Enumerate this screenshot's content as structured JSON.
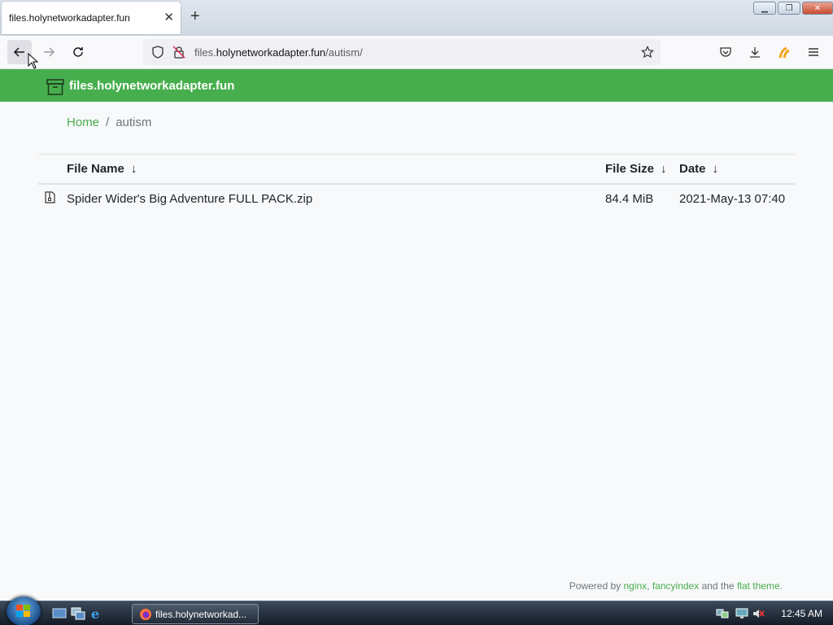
{
  "browser": {
    "tab_title": "files.holynetworkadapter.fun",
    "url_host": "files.holynetworkadapter.fun",
    "url_prefix": "files.",
    "url_domain": "holynetworkadapter.fun",
    "url_path": "/autism/"
  },
  "site": {
    "title": "files.holynetworkadapter.fun",
    "accent_color": "#47ae4d"
  },
  "breadcrumb": {
    "home": "Home",
    "separator": "/",
    "current": "autism"
  },
  "table": {
    "headers": {
      "name": "File Name",
      "size": "File Size",
      "date": "Date",
      "sort_arrow": "↓"
    },
    "rows": [
      {
        "icon": "zip-file-icon",
        "name": "Spider Wider's Big Adventure FULL PACK.zip",
        "size": "84.4 MiB",
        "date": "2021-May-13 07:40"
      }
    ]
  },
  "footer": {
    "prefix": "Powered by",
    "link1": "nginx",
    "comma": ",",
    "link2": "fancyindex",
    "middle": "and the",
    "link3": "flat theme",
    "suffix": "."
  },
  "taskbar": {
    "task_label": "files.holynetworkad...",
    "clock": "12:45 AM"
  }
}
